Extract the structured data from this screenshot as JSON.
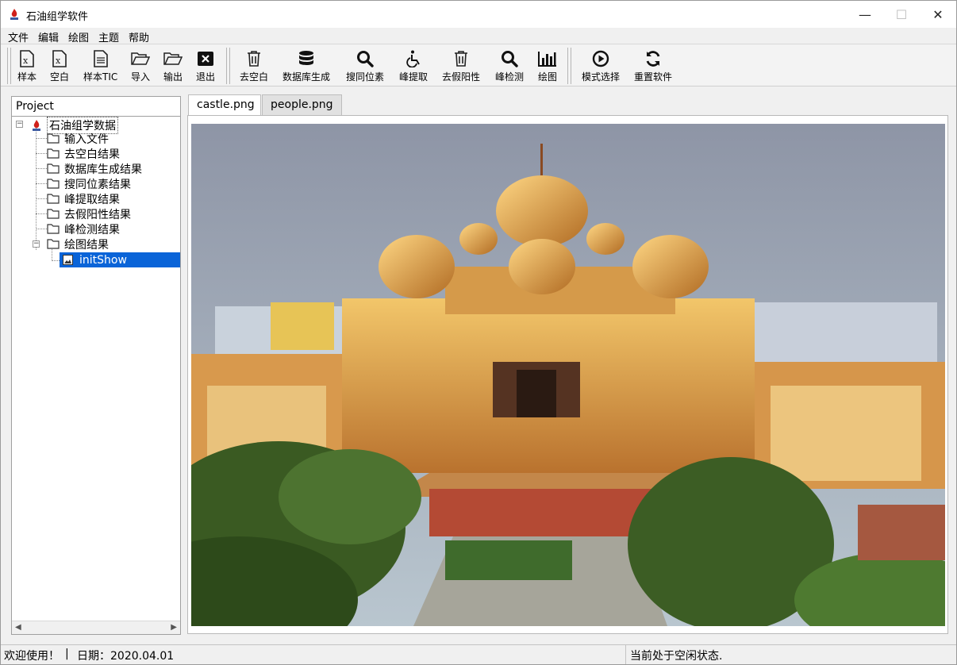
{
  "window": {
    "title": "石油组学软件",
    "minimize": "—",
    "maximize": "☐",
    "close": "✕"
  },
  "menu": [
    "文件",
    "编辑",
    "绘图",
    "主题",
    "帮助"
  ],
  "toolbar": {
    "groups": [
      [
        "样本",
        "空白",
        "样本TIC",
        "导入",
        "输出",
        "退出"
      ],
      [
        "去空白",
        "数据库生成",
        "搜同位素",
        "峰提取",
        "去假阳性",
        "峰检测",
        "绘图"
      ],
      [
        "模式选择",
        "重置软件"
      ]
    ]
  },
  "project": {
    "header": "Project",
    "root": "石油组学数据",
    "folders": [
      "输入文件",
      "去空白结果",
      "数据库生成结果",
      "搜同位素结果",
      "峰提取结果",
      "去假阳性结果",
      "峰检测结果",
      "绘图结果"
    ],
    "selected_child": "initShow"
  },
  "tabs": [
    "castle.png",
    "people.png"
  ],
  "status": {
    "welcome": "欢迎使用！",
    "separator": "|",
    "date": "日期：2020.04.01",
    "state": "当前处于空闲状态."
  }
}
